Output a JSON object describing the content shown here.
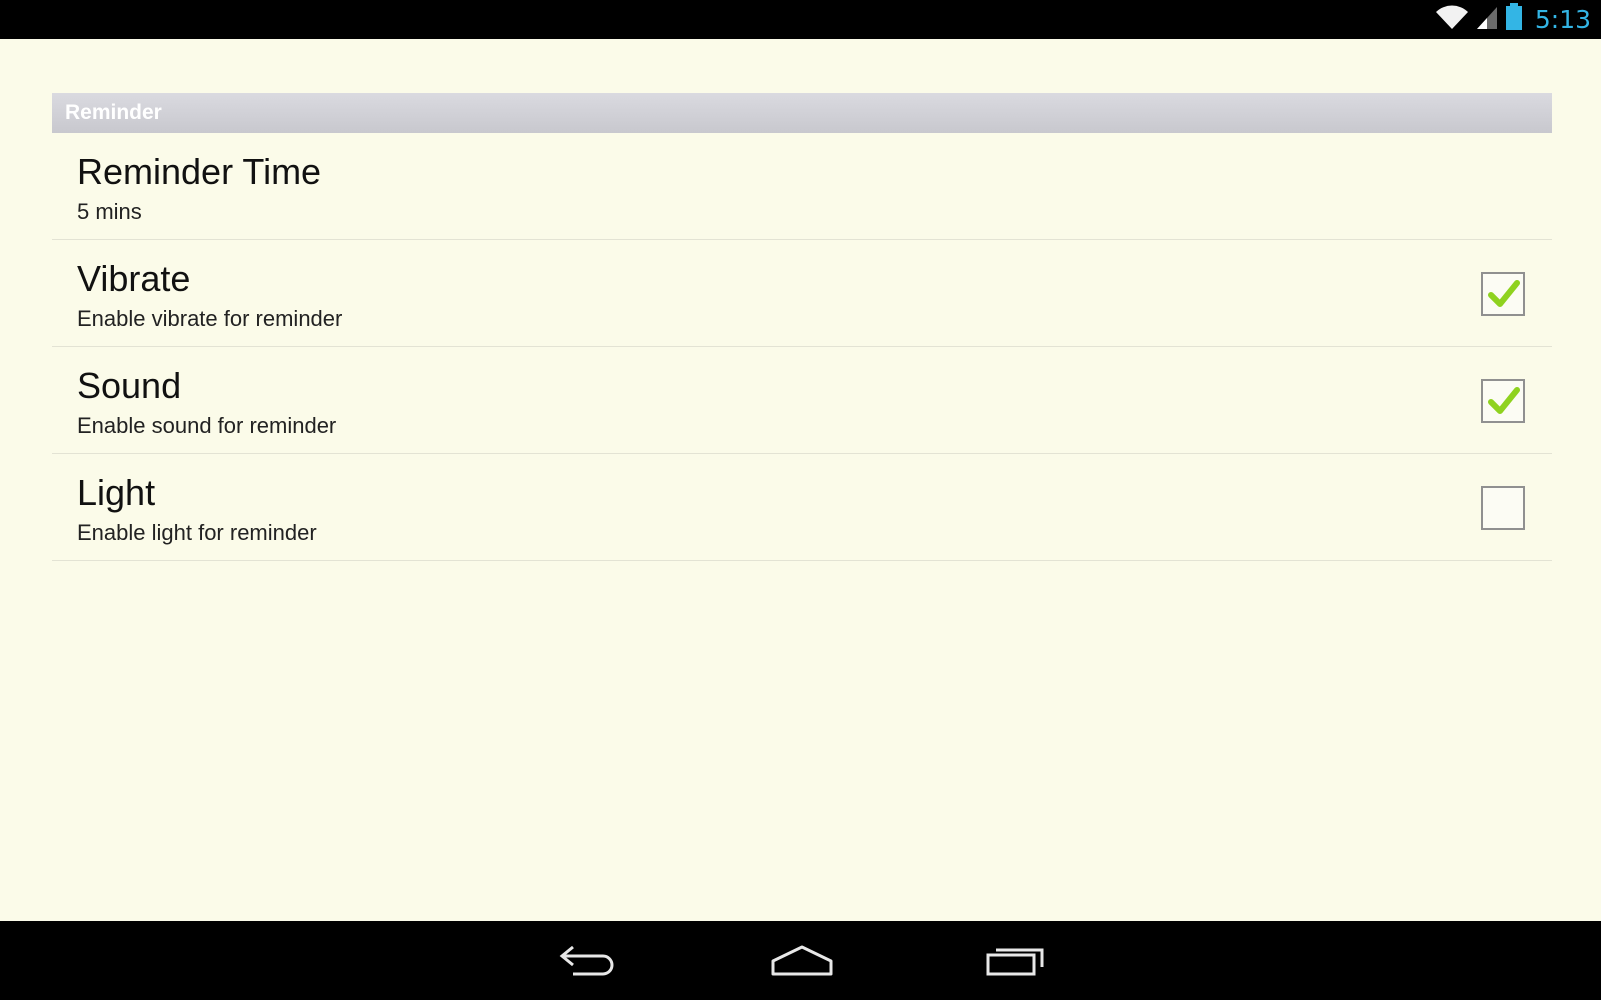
{
  "status_bar": {
    "time": "5:13",
    "icons": [
      "wifi-icon",
      "cell-signal-icon",
      "battery-icon"
    ],
    "time_color": "#33b5e5"
  },
  "category": {
    "title": "Reminder"
  },
  "preferences": [
    {
      "title": "Reminder Time",
      "summary": "5 mins"
    },
    {
      "title": "Vibrate",
      "summary": "Enable vibrate for reminder",
      "checked": true
    },
    {
      "title": "Sound",
      "summary": "Enable sound for reminder",
      "checked": true
    },
    {
      "title": "Light",
      "summary": "Enable light for reminder",
      "checked": false
    }
  ],
  "nav_bar": {
    "buttons": [
      "back-icon",
      "home-icon",
      "recent-apps-icon"
    ]
  },
  "colors": {
    "background": "#fbfbe9",
    "check_green": "#8fd21f",
    "header_bg": "#d2d2d8"
  }
}
